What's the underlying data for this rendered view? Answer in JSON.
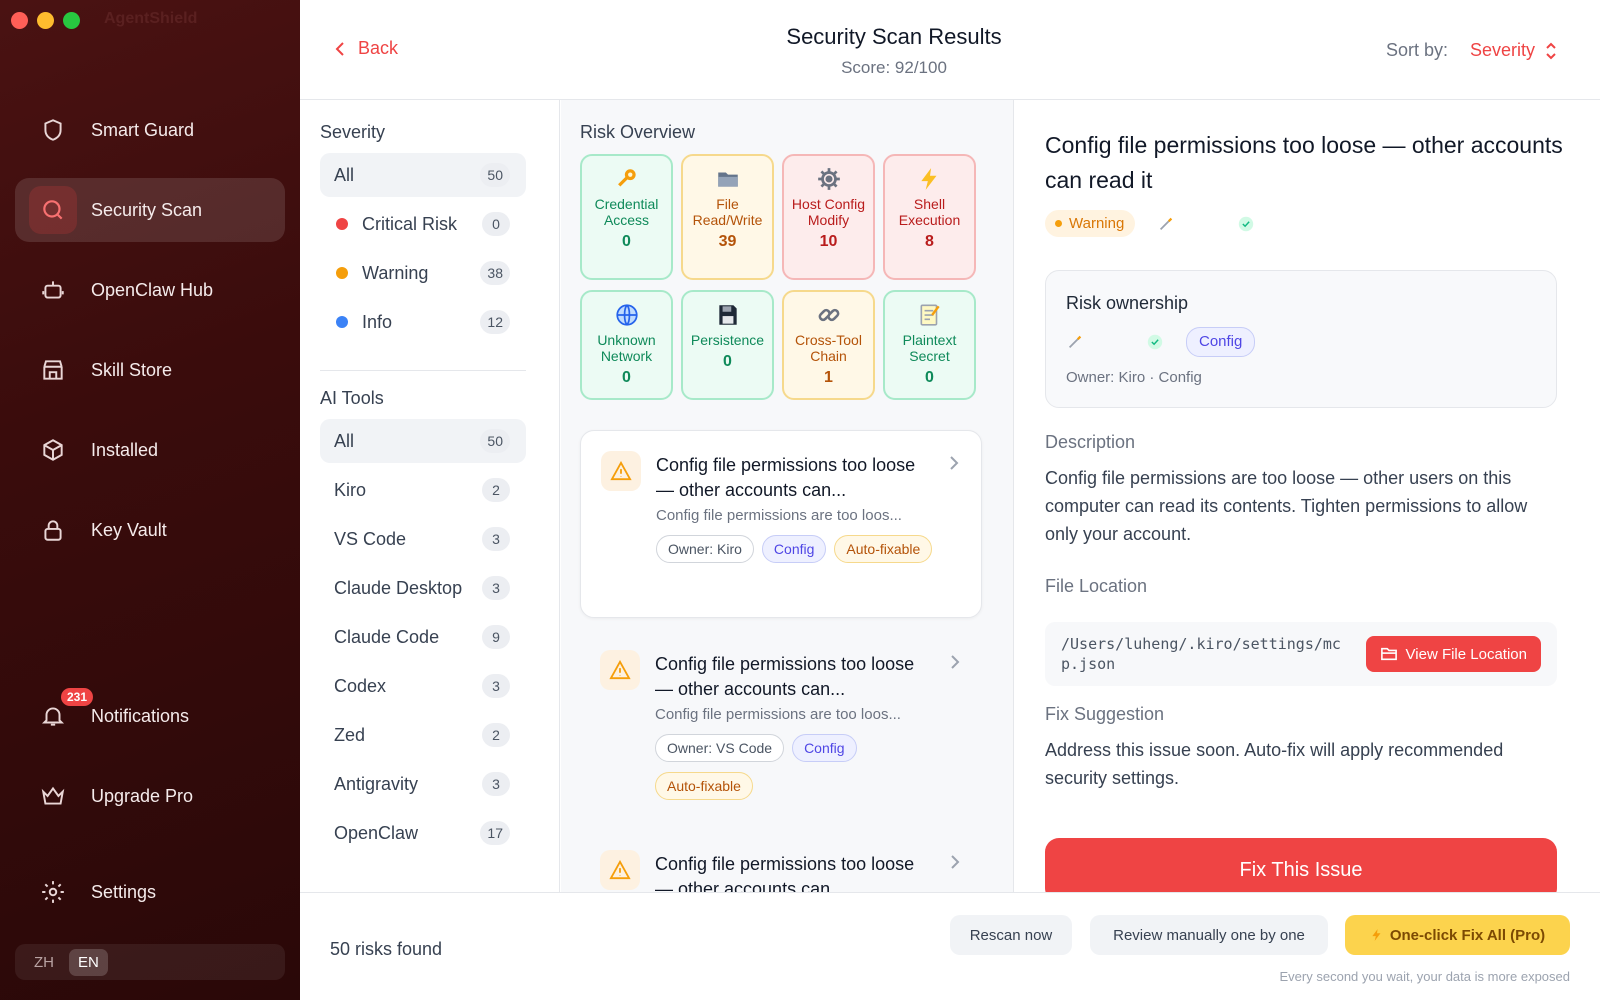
{
  "window": {
    "title": "AgentShield"
  },
  "sidebar": {
    "items": [
      {
        "label": "Smart Guard",
        "icon": "shield-icon"
      },
      {
        "label": "Security Scan",
        "icon": "search-icon",
        "active": true
      },
      {
        "label": "OpenClaw Hub",
        "icon": "robot-icon"
      },
      {
        "label": "Skill Store",
        "icon": "store-icon"
      },
      {
        "label": "Installed",
        "icon": "package-icon"
      },
      {
        "label": "Key Vault",
        "icon": "lock-icon"
      }
    ],
    "notifications": {
      "label": "Notifications",
      "badge": "231"
    },
    "upgrade": {
      "label": "Upgrade Pro"
    },
    "settings": {
      "label": "Settings"
    },
    "lang": {
      "zh": "ZH",
      "en": "EN",
      "selected": "EN"
    }
  },
  "header": {
    "back": "Back",
    "title": "Security Scan Results",
    "score": "Score: 92/100",
    "sort_label": "Sort by:",
    "sort_value": "Severity"
  },
  "filters": {
    "severity_title": "Severity",
    "severity": [
      {
        "label": "All",
        "count": "50",
        "selected": true
      },
      {
        "label": "Critical Risk",
        "count": "0",
        "color": "#ef4444"
      },
      {
        "label": "Warning",
        "count": "38",
        "color": "#f59e0b"
      },
      {
        "label": "Info",
        "count": "12",
        "color": "#3b82f6"
      }
    ],
    "tools_title": "AI Tools",
    "tools": [
      {
        "label": "All",
        "count": "50",
        "selected": true
      },
      {
        "label": "Kiro",
        "count": "2"
      },
      {
        "label": "VS Code",
        "count": "3"
      },
      {
        "label": "Claude Desktop",
        "count": "3"
      },
      {
        "label": "Claude Code",
        "count": "9"
      },
      {
        "label": "Codex",
        "count": "3"
      },
      {
        "label": "Zed",
        "count": "2"
      },
      {
        "label": "Antigravity",
        "count": "3"
      },
      {
        "label": "OpenClaw",
        "count": "17"
      }
    ]
  },
  "overview": {
    "title": "Risk Overview",
    "tiles": [
      {
        "label": "Credential Access",
        "value": "0",
        "tone": "green",
        "icon": "key-icon"
      },
      {
        "label": "File Read/Write",
        "value": "39",
        "tone": "yellow",
        "icon": "folder-icon"
      },
      {
        "label": "Host Config Modify",
        "value": "10",
        "tone": "red",
        "icon": "gear-icon"
      },
      {
        "label": "Shell Execution",
        "value": "8",
        "tone": "red",
        "icon": "lightning-icon"
      },
      {
        "label": "Unknown Network",
        "value": "0",
        "tone": "green",
        "icon": "globe-icon"
      },
      {
        "label": "Persistence",
        "value": "0",
        "tone": "green",
        "icon": "floppy-icon"
      },
      {
        "label": "Cross-Tool Chain",
        "value": "1",
        "tone": "yellow",
        "icon": "link-icon"
      },
      {
        "label": "Plaintext Secret",
        "value": "0",
        "tone": "green",
        "icon": "memo-icon"
      }
    ]
  },
  "risks": [
    {
      "title": "Config file permissions too loose — other accounts can...",
      "desc": "Config file permissions are too loos...",
      "owner": "Owner: Kiro",
      "category": "Config",
      "autofix": "Auto-fixable",
      "selected": true
    },
    {
      "title": "Config file permissions too loose — other accounts can...",
      "desc": "Config file permissions are too loos...",
      "owner": "Owner: VS Code",
      "category": "Config",
      "autofix": "Auto-fixable"
    },
    {
      "title": "Config file permissions too loose — other accounts can...",
      "desc": "",
      "owner": "",
      "category": "",
      "autofix": ""
    }
  ],
  "detail": {
    "title": "Config file permissions too loose — other accounts can read it",
    "severity": "Warning",
    "ownership_title": "Risk ownership",
    "ownership_tag": "Config",
    "ownership_sub": "Owner: Kiro · Config",
    "description_title": "Description",
    "description": "Config file permissions are too loose — other users on this computer can read its contents. Tighten permissions to allow only your account.",
    "location_title": "File Location",
    "path": "/Users/luheng/.kiro/settings/mcp.json",
    "view_button": "View File Location",
    "fix_title": "Fix Suggestion",
    "fix": "Address this issue soon. Auto-fix will apply recommended security settings.",
    "fix_button": "Fix This Issue"
  },
  "footer": {
    "found": "50 risks found",
    "rescan": "Rescan now",
    "review": "Review manually one by one",
    "fix_all": "One-click Fix All (Pro)",
    "hint": "Every second you wait, your data is more exposed"
  }
}
